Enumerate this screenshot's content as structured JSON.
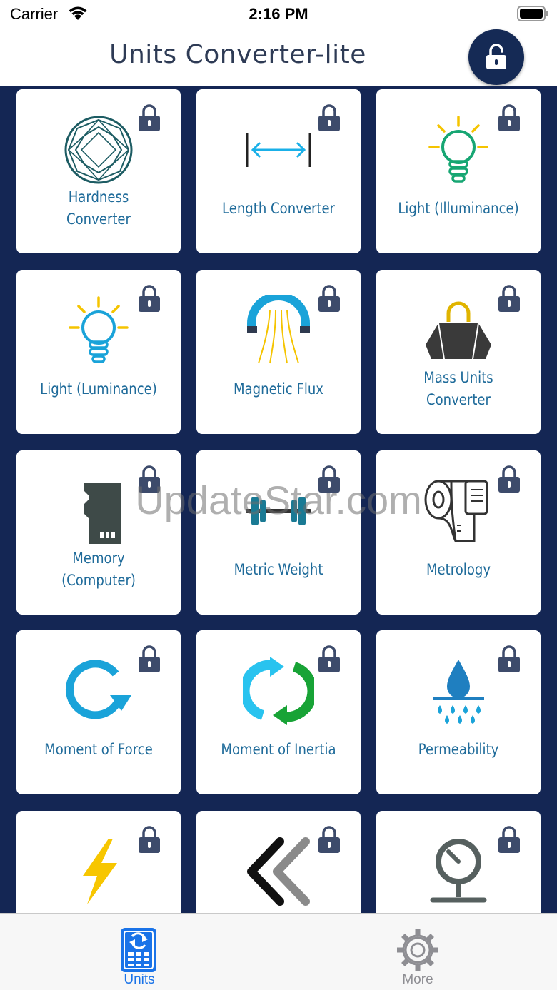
{
  "status_bar": {
    "carrier": "Carrier",
    "time": "2:16 PM"
  },
  "nav": {
    "title": "Units Converter-lite",
    "unlock_icon": "unlocked-padlock-icon"
  },
  "watermark": "UpdateStar.com",
  "tiles": [
    {
      "label": "Hardness\nConverter",
      "icon": "diamond-icon"
    },
    {
      "label": "Length Converter",
      "icon": "length-arrow-icon"
    },
    {
      "label": "Light (Illuminance)",
      "icon": "light-bulb-green-icon"
    },
    {
      "label": "Light (Luminance)",
      "icon": "light-bulb-blue-icon"
    },
    {
      "label": "Magnetic Flux",
      "icon": "magnet-icon"
    },
    {
      "label": "Mass Units\nConverter",
      "icon": "weight-icon"
    },
    {
      "label": "Memory\n(Computer)",
      "icon": "memory-card-icon"
    },
    {
      "label": "Metric Weight",
      "icon": "dumbbell-icon"
    },
    {
      "label": "Metrology",
      "icon": "measuring-tape-icon"
    },
    {
      "label": "Moment of Force",
      "icon": "rotation-arrow-icon"
    },
    {
      "label": "Moment of Inertia",
      "icon": "cycle-arrows-icon"
    },
    {
      "label": "Permeability",
      "icon": "water-drop-icon"
    },
    {
      "label": "",
      "icon": "lightning-bolt-icon"
    },
    {
      "label": "",
      "icon": "double-chevron-left-icon"
    },
    {
      "label": "",
      "icon": "pressure-gauge-icon"
    }
  ],
  "tabs": [
    {
      "label": "Units",
      "icon": "calculator-icon",
      "active": true
    },
    {
      "label": "More",
      "icon": "gear-icon",
      "active": false
    }
  ],
  "colors": {
    "grid_background": "#142654",
    "tile_label": "#1f6b9a",
    "nav_title": "#2e3b55",
    "tab_active": "#1a73e8",
    "tab_inactive": "#8e8e93"
  }
}
